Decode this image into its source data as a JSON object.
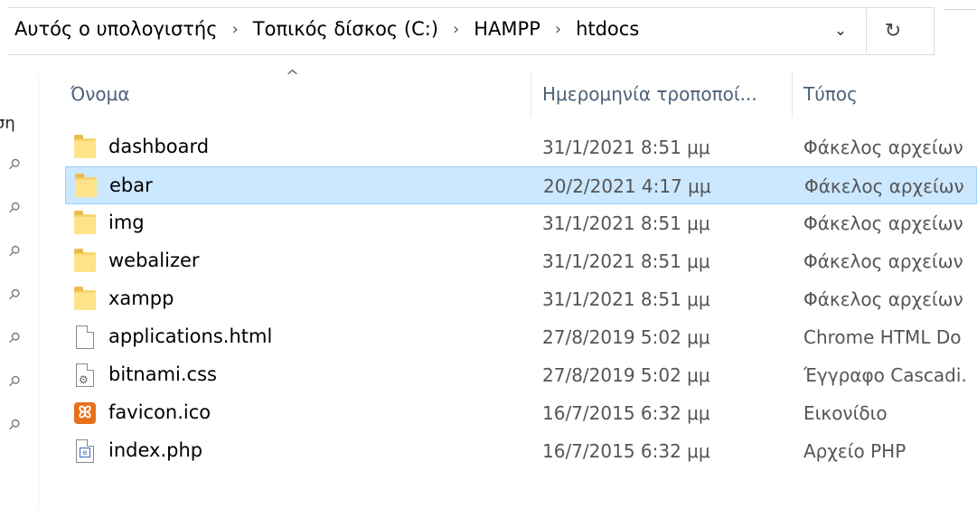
{
  "breadcrumb": [
    {
      "label": "Αυτός ο υπολογιστής"
    },
    {
      "label": "Τοπικός δίσκος (C:)"
    },
    {
      "label": "HAMPP"
    },
    {
      "label": "htdocs"
    }
  ],
  "address_bar": {
    "separator": "›",
    "dropdown_icon": "chevron-down",
    "dropdown_glyph": "⌄",
    "refresh_icon": "refresh",
    "refresh_glyph": "↻"
  },
  "nav_pane": {
    "partial_label": "ση",
    "pinned_count": 7,
    "pin_glyph": "📌"
  },
  "columns": {
    "sort_glyph": "^",
    "name": "Όνομα",
    "date": "Ημερομηνία τροποποί...",
    "type": "Τύπος"
  },
  "files": [
    {
      "name": "dashboard",
      "date": "31/1/2021 8:51 μμ",
      "type": "Φάκελος αρχείων",
      "kind": "folder",
      "selected": false
    },
    {
      "name": "ebar",
      "date": "20/2/2021 4:17 μμ",
      "type": "Φάκελος αρχείων",
      "kind": "folder",
      "selected": true
    },
    {
      "name": "img",
      "date": "31/1/2021 8:51 μμ",
      "type": "Φάκελος αρχείων",
      "kind": "folder",
      "selected": false
    },
    {
      "name": "webalizer",
      "date": "31/1/2021 8:51 μμ",
      "type": "Φάκελος αρχείων",
      "kind": "folder",
      "selected": false
    },
    {
      "name": "xampp",
      "date": "31/1/2021 8:51 μμ",
      "type": "Φάκελος αρχείων",
      "kind": "folder",
      "selected": false
    },
    {
      "name": "applications.html",
      "date": "27/8/2019 5:02 μμ",
      "type": "Chrome HTML Do",
      "kind": "html",
      "selected": false
    },
    {
      "name": "bitnami.css",
      "date": "27/8/2019 5:02 μμ",
      "type": "Έγγραφο Cascadi.",
      "kind": "css",
      "selected": false
    },
    {
      "name": "favicon.ico",
      "date": "16/7/2015 6:32 μμ",
      "type": "Εικονίδιο",
      "kind": "ico",
      "selected": false
    },
    {
      "name": "index.php",
      "date": "16/7/2015 6:32 μμ",
      "type": "Αρχείο PHP",
      "kind": "php",
      "selected": false
    }
  ],
  "colors": {
    "selection_bg": "#cce8ff",
    "selection_border": "#99d1ff",
    "header_text": "#4c6077",
    "folder": "#ffe38a"
  }
}
